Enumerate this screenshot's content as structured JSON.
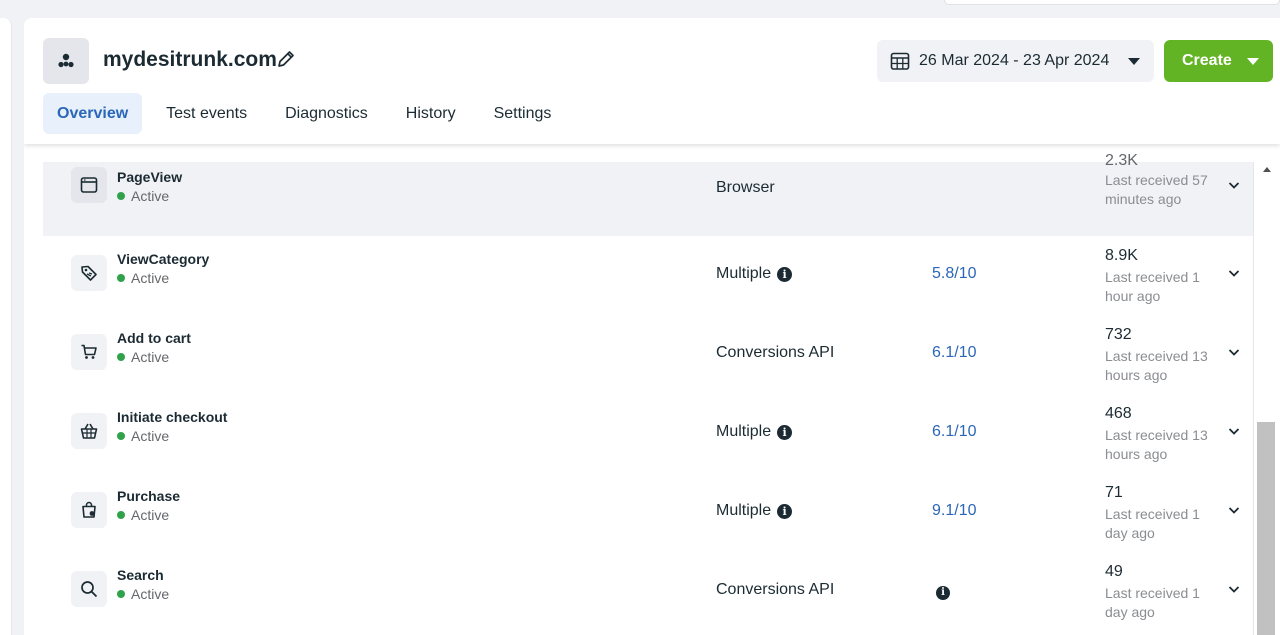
{
  "header": {
    "site_title": "mydesitrunk.com",
    "date_range": "26 Mar 2024 - 23 Apr 2024",
    "create_label": "Create"
  },
  "tabs": [
    {
      "label": "Overview",
      "active": true
    },
    {
      "label": "Test events",
      "active": false
    },
    {
      "label": "Diagnostics",
      "active": false
    },
    {
      "label": "History",
      "active": false
    },
    {
      "label": "Settings",
      "active": false
    }
  ],
  "colors": {
    "accent_blue": "#2b66b8",
    "create_green": "#63b424",
    "status_active": "#31a24c"
  },
  "events": [
    {
      "name": "PageView",
      "status": "Active",
      "icon": "browser-window-icon",
      "source": "Browser",
      "source_info": false,
      "score": "",
      "score_info": false,
      "count": "2.3K",
      "last_received": "Last received 57 minutes ago"
    },
    {
      "name": "ViewCategory",
      "status": "Active",
      "icon": "tag-icon",
      "source": "Multiple",
      "source_info": true,
      "score": "5.8/10",
      "score_info": false,
      "count": "8.9K",
      "last_received": "Last received 1 hour ago"
    },
    {
      "name": "Add to cart",
      "status": "Active",
      "icon": "cart-icon",
      "source": "Conversions API",
      "source_info": false,
      "score": "6.1/10",
      "score_info": false,
      "count": "732",
      "last_received": "Last received 13 hours ago"
    },
    {
      "name": "Initiate checkout",
      "status": "Active",
      "icon": "basket-icon",
      "source": "Multiple",
      "source_info": true,
      "score": "6.1/10",
      "score_info": false,
      "count": "468",
      "last_received": "Last received 13 hours ago"
    },
    {
      "name": "Purchase",
      "status": "Active",
      "icon": "shopping-bag-icon",
      "source": "Multiple",
      "source_info": true,
      "score": "9.1/10",
      "score_info": false,
      "count": "71",
      "last_received": "Last received 1 day ago"
    },
    {
      "name": "Search",
      "status": "Active",
      "icon": "search-icon",
      "source": "Conversions API",
      "source_info": false,
      "score": "",
      "score_info": true,
      "count": "49",
      "last_received": "Last received 1 day ago"
    }
  ]
}
